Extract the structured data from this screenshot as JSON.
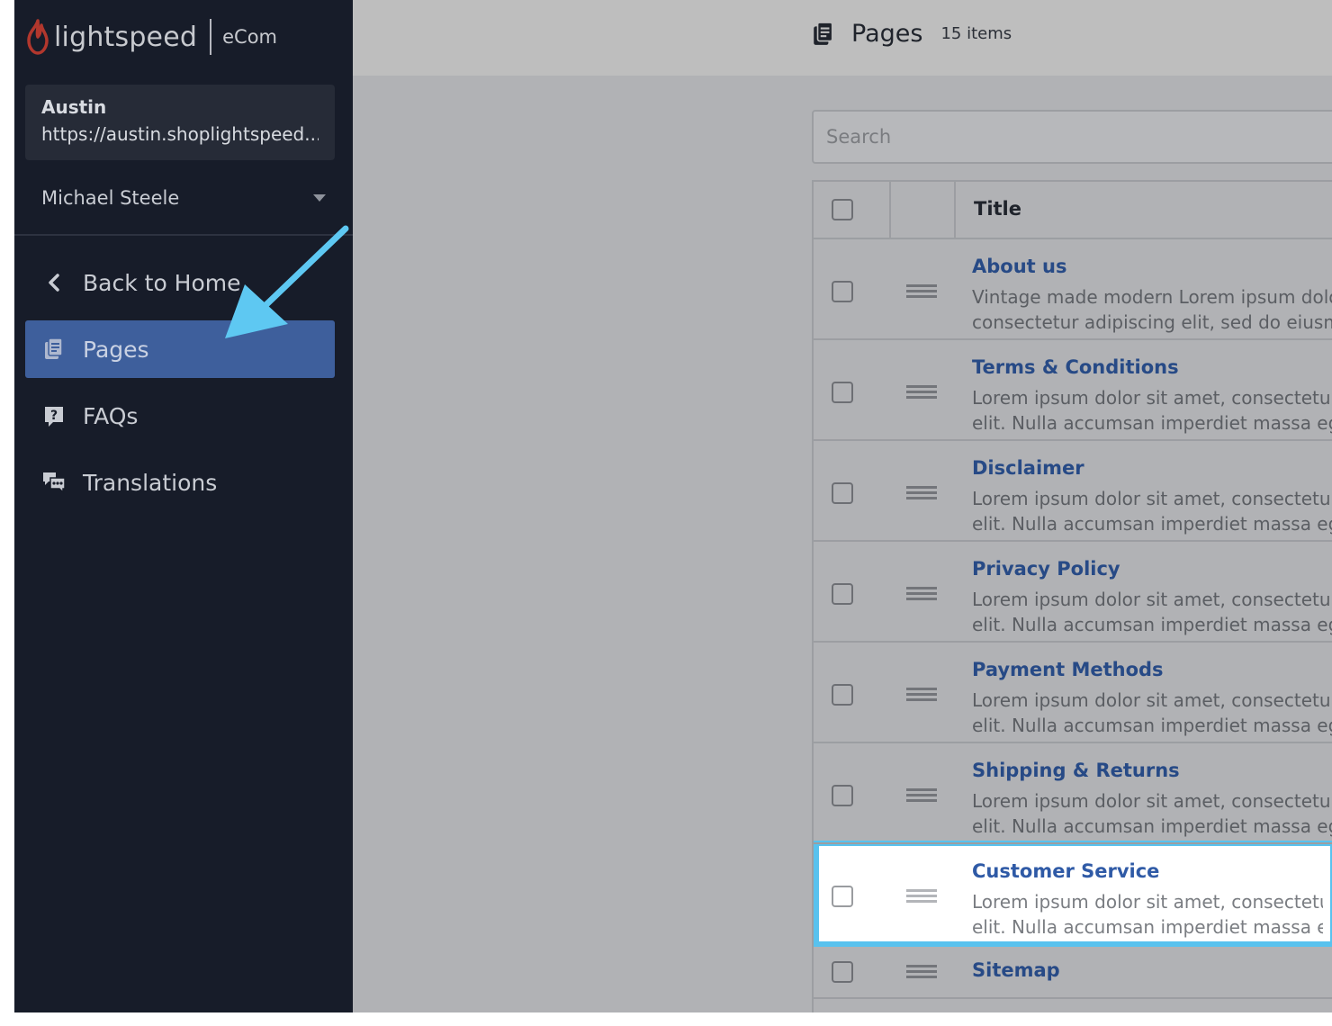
{
  "brand": {
    "name": "lightspeed",
    "product": "eCom"
  },
  "store": {
    "name": "Austin",
    "url": "https://austin.shoplightspeed...."
  },
  "user": {
    "name": "Michael Steele"
  },
  "nav": {
    "back": "Back to Home",
    "items": [
      {
        "label": "Pages",
        "icon": "pages-icon",
        "active": true
      },
      {
        "label": "FAQs",
        "icon": "question-icon",
        "active": false
      },
      {
        "label": "Translations",
        "icon": "chat-icon",
        "active": false
      }
    ]
  },
  "header": {
    "title": "Pages",
    "count": "15 items"
  },
  "search": {
    "placeholder": "Search"
  },
  "table": {
    "title_header": "Title",
    "rows": [
      {
        "title": "About us",
        "line1": "Vintage made modern Lorem ipsum dolor",
        "line2": "consectetur adipiscing elit, sed do eiusmo"
      },
      {
        "title": "Terms & Conditions",
        "line1": "Lorem ipsum dolor sit amet, consectetur a",
        "line2": "elit. Nulla accumsan imperdiet massa eget"
      },
      {
        "title": "Disclaimer",
        "line1": "Lorem ipsum dolor sit amet, consectetur a",
        "line2": "elit. Nulla accumsan imperdiet massa eget"
      },
      {
        "title": "Privacy Policy",
        "line1": "Lorem ipsum dolor sit amet, consectetur a",
        "line2": "elit. Nulla accumsan imperdiet massa eget"
      },
      {
        "title": "Payment Methods",
        "line1": "Lorem ipsum dolor sit amet, consectetur a",
        "line2": "elit. Nulla accumsan imperdiet massa eget"
      },
      {
        "title": "Shipping & Returns",
        "line1": "Lorem ipsum dolor sit amet, consectetur a",
        "line2": "elit. Nulla accumsan imperdiet massa eget"
      },
      {
        "title": "Customer Service",
        "line1": "Lorem ipsum dolor sit amet, consectetur",
        "line2": "elit. Nulla accumsan imperdiet massa ege"
      },
      {
        "title": "Sitemap",
        "line1": "",
        "line2": ""
      }
    ]
  },
  "colors": {
    "sidebar": "#171c29",
    "active_nav": "#3e5f9c",
    "link": "#274a86",
    "highlight": "#58c2ee",
    "arrow": "#5ec8f2"
  }
}
